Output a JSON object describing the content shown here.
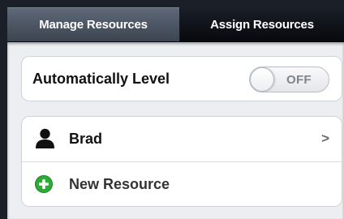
{
  "tabs": [
    {
      "label": "Manage Resources",
      "selected": true
    },
    {
      "label": "Assign Resources",
      "selected": false
    }
  ],
  "settings": {
    "auto_level_label": "Automatically Level",
    "toggle_state": "OFF"
  },
  "resources": {
    "items": [
      {
        "name": "Brad",
        "icon": "person-icon"
      }
    ],
    "new_resource_label": "New Resource",
    "new_resource_icon": "plus-circle-icon"
  },
  "colors": {
    "add_green": "#2dab36",
    "tab_selected": "#4a5260"
  }
}
